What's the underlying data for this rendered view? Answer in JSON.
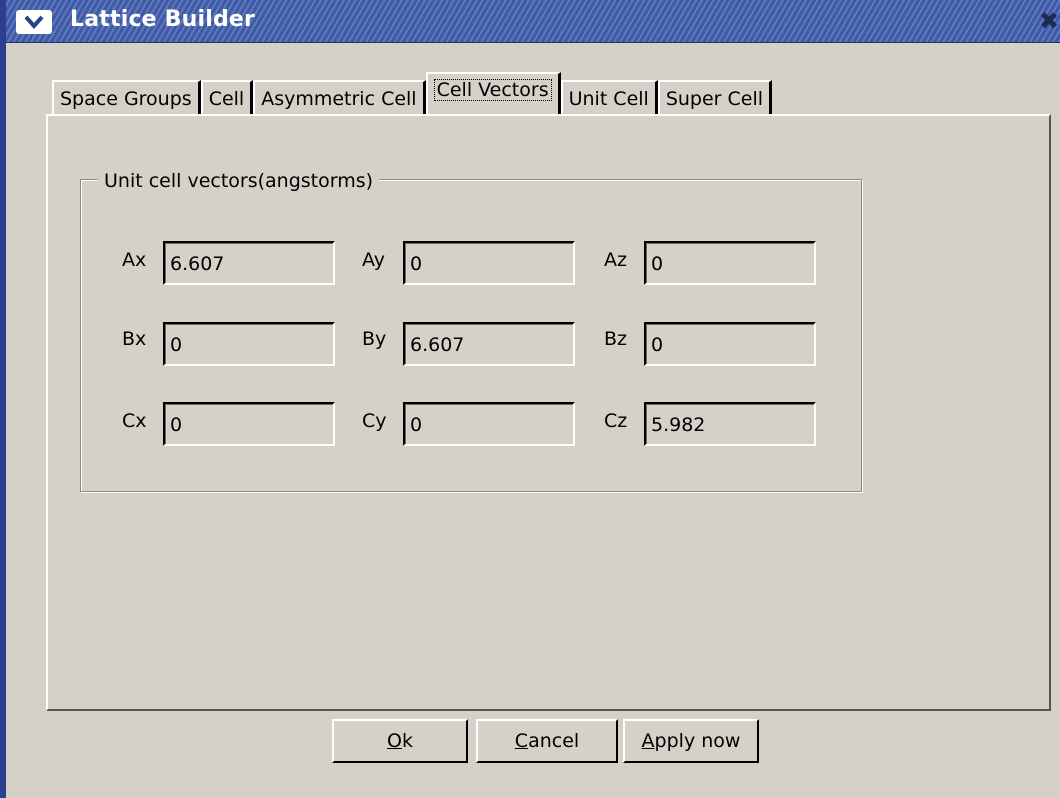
{
  "window": {
    "title": "Lattice Builder",
    "menu_icon": "chevron-down-icon",
    "close_icon": "close-icon",
    "close_glyph": "✖"
  },
  "tabs": [
    {
      "label": "Space Groups",
      "active": false
    },
    {
      "label": "Cell",
      "active": false
    },
    {
      "label": "Asymmetric Cell",
      "active": false
    },
    {
      "label": "Cell Vectors",
      "active": true
    },
    {
      "label": "Unit Cell",
      "active": false
    },
    {
      "label": "Super Cell",
      "active": false
    }
  ],
  "frame": {
    "label": "Unit cell vectors(angstorms)"
  },
  "fields": {
    "ax": {
      "label": "Ax",
      "value": "6.607"
    },
    "ay": {
      "label": "Ay",
      "value": "0"
    },
    "az": {
      "label": "Az",
      "value": "0"
    },
    "bx": {
      "label": "Bx",
      "value": "0"
    },
    "by": {
      "label": "By",
      "value": "6.607"
    },
    "bz": {
      "label": "Bz",
      "value": "0"
    },
    "cx": {
      "label": "Cx",
      "value": "0"
    },
    "cy": {
      "label": "Cy",
      "value": "0"
    },
    "cz": {
      "label": "Cz",
      "value": "5.982"
    }
  },
  "buttons": {
    "ok": {
      "mnemonic": "O",
      "rest": "k"
    },
    "cancel": {
      "mnemonic": "C",
      "rest": "ancel"
    },
    "apply": {
      "mnemonic": "A",
      "rest": "pply now"
    }
  }
}
